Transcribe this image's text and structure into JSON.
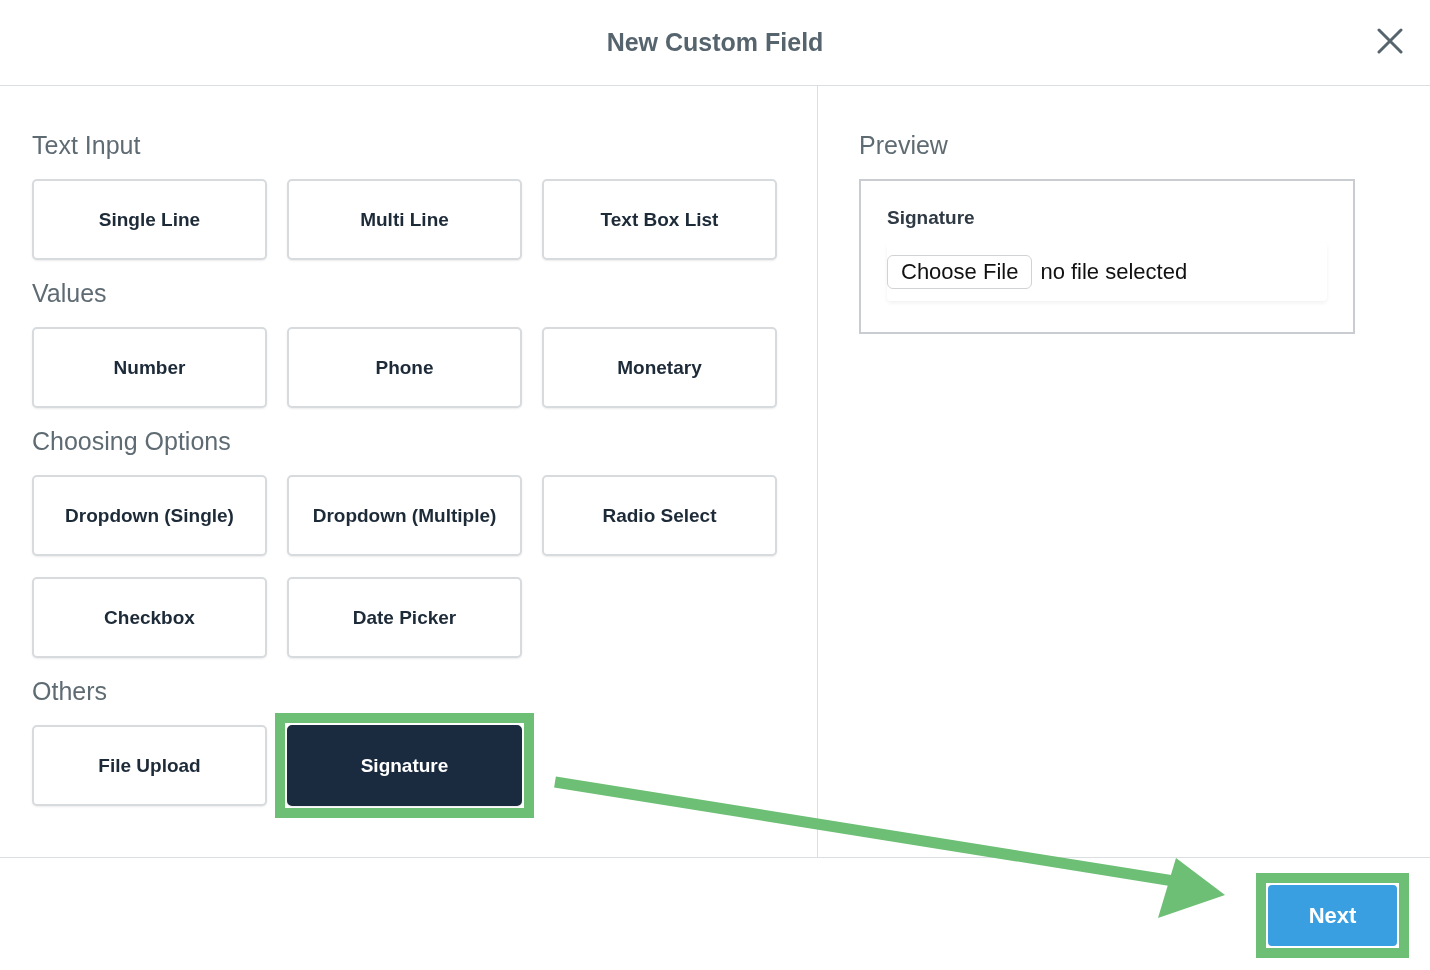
{
  "dialog": {
    "title": "New Custom Field"
  },
  "groups": [
    {
      "heading": "Text Input",
      "options": [
        {
          "label": "Single Line",
          "selected": false
        },
        {
          "label": "Multi Line",
          "selected": false
        },
        {
          "label": "Text Box List",
          "selected": false
        }
      ]
    },
    {
      "heading": "Values",
      "options": [
        {
          "label": "Number",
          "selected": false
        },
        {
          "label": "Phone",
          "selected": false
        },
        {
          "label": "Monetary",
          "selected": false
        }
      ]
    },
    {
      "heading": "Choosing Options",
      "options": [
        {
          "label": "Dropdown (Single)",
          "selected": false
        },
        {
          "label": "Dropdown (Multiple)",
          "selected": false
        },
        {
          "label": "Radio Select",
          "selected": false
        },
        {
          "label": "Checkbox",
          "selected": false
        },
        {
          "label": "Date Picker",
          "selected": false
        }
      ]
    },
    {
      "heading": "Others",
      "options": [
        {
          "label": "File Upload",
          "selected": false
        },
        {
          "label": "Signature",
          "selected": true
        }
      ]
    }
  ],
  "preview": {
    "heading": "Preview",
    "field_label": "Signature",
    "file_button": "Choose File",
    "file_status": "no file selected"
  },
  "footer": {
    "next_button": "Next"
  },
  "annotations": {
    "highlight_selected": true,
    "highlight_next": true,
    "arrow": true
  }
}
